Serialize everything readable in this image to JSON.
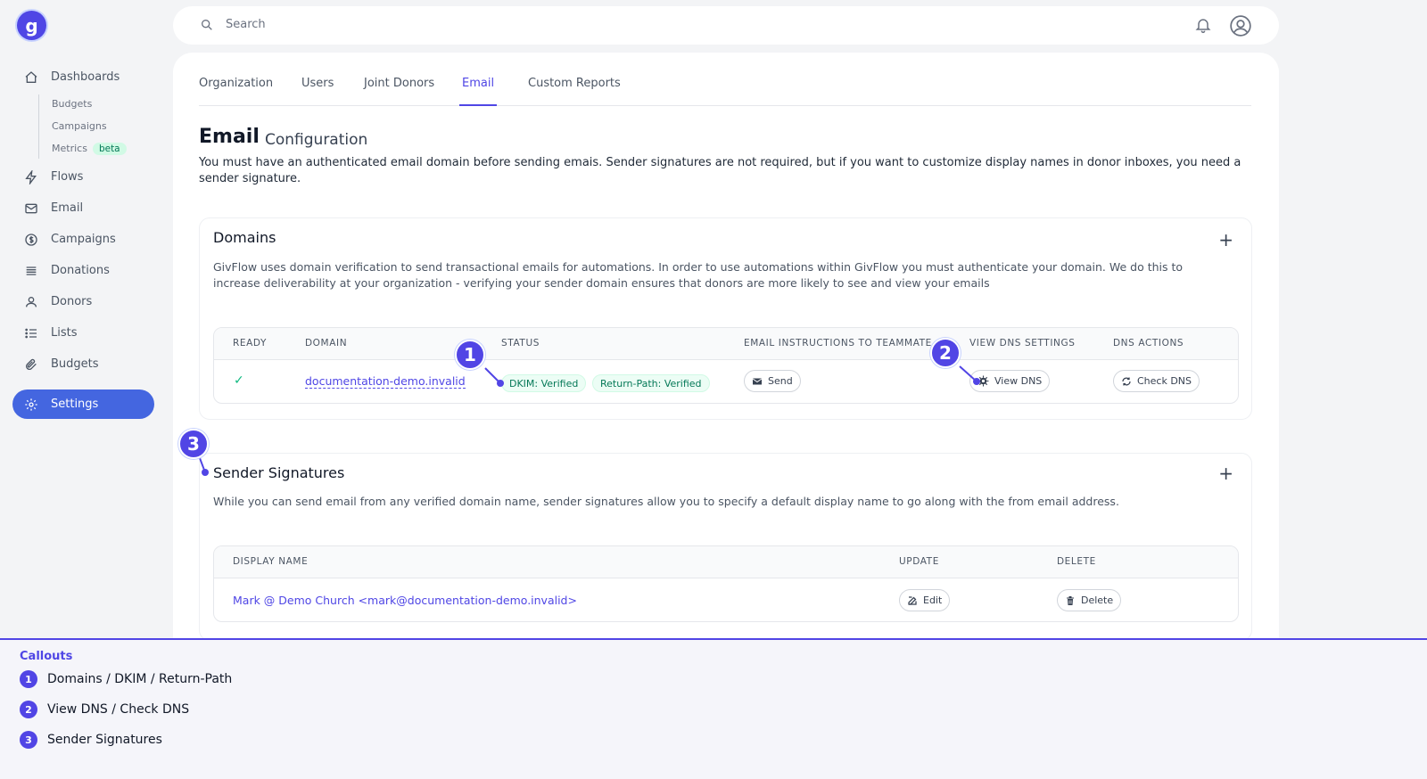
{
  "sidebar": {
    "logo_letter": "g",
    "items": [
      {
        "label": "Dashboards",
        "icon": "home-icon"
      },
      {
        "label": "Flows",
        "icon": "bolt-icon"
      },
      {
        "label": "Email",
        "icon": "envelope-icon"
      },
      {
        "label": "Campaigns",
        "icon": "dollar-icon"
      },
      {
        "label": "Donations",
        "icon": "list-icon"
      },
      {
        "label": "Donors",
        "icon": "users-icon"
      },
      {
        "label": "Lists",
        "icon": "bulleted-list-icon"
      },
      {
        "label": "Budgets",
        "icon": "paperclip-icon"
      },
      {
        "label": "Settings",
        "icon": "gear-icon",
        "active": true
      }
    ],
    "subitems": [
      {
        "label": "Budgets"
      },
      {
        "label": "Campaigns"
      },
      {
        "label": "Metrics",
        "badge": "beta"
      }
    ]
  },
  "topbar": {
    "search_placeholder": "Search"
  },
  "tabs": [
    {
      "label": "Organization"
    },
    {
      "label": "Users"
    },
    {
      "label": "Joint Donors"
    },
    {
      "label": "Email",
      "active": true
    },
    {
      "label": "Custom Reports"
    }
  ],
  "page": {
    "title": "Email",
    "subtitle": "Configuration",
    "intro": "You must have an authenticated email domain before sending emais. Sender signatures are not required, but if you want to customize display names in donor inboxes, you need a sender signature."
  },
  "domains": {
    "title": "Domains",
    "description": "GivFlow uses domain verification to send transactional emails for automations. In order to use automations within GivFlow you must authenticate your domain. We do this to increase deliverability at your organization - verifying your sender domain ensures that donors are more likely to see and view your emails",
    "columns": [
      "READY",
      "DOMAIN",
      "STATUS",
      "EMAIL INSTRUCTIONS TO TEAMMATE",
      "VIEW DNS SETTINGS",
      "DNS ACTIONS"
    ],
    "rows": [
      {
        "ready": "✓",
        "domain": "documentation-demo.invalid",
        "dkim": "DKIM: Verified",
        "return_path": "Return-Path: Verified",
        "send_label": "Send",
        "view_dns_label": "View DNS",
        "check_dns_label": "Check DNS"
      }
    ]
  },
  "signatures": {
    "title": "Sender Signatures",
    "description": "While you can send email from any verified domain name, sender signatures allow you to specify a default display name to go along with the from email address.",
    "columns": [
      "DISPLAY NAME",
      "UPDATE",
      "DELETE"
    ],
    "rows": [
      {
        "display_name": "Mark @ Demo Church <mark@documentation-demo.invalid>",
        "edit_label": "Edit",
        "delete_label": "Delete"
      }
    ]
  },
  "markers": [
    "1",
    "2",
    "3"
  ],
  "callouts": {
    "title": "Callouts",
    "items": [
      {
        "num": "1",
        "text": "Domains / DKIM / Return-Path"
      },
      {
        "num": "2",
        "text": "View DNS / Check DNS"
      },
      {
        "num": "3",
        "text": "Sender Signatures"
      }
    ]
  },
  "colors": {
    "accent": "#4f46e5",
    "active_nav": "#4466e0",
    "success": "#047857"
  }
}
